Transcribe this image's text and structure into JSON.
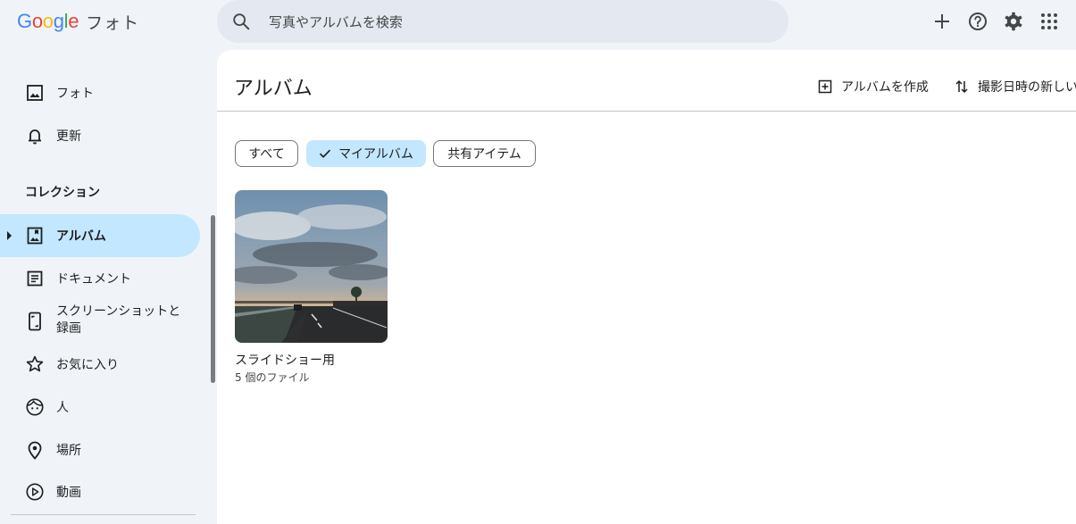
{
  "header": {
    "logo_text": "Google",
    "app_name": "フォト",
    "search_placeholder": "写真やアルバムを検索",
    "buttons": [
      {
        "name": "add",
        "icon": "plus-icon"
      },
      {
        "name": "help",
        "icon": "help-icon"
      },
      {
        "name": "settings",
        "icon": "gear-icon"
      },
      {
        "name": "apps",
        "icon": "apps-grid-icon"
      }
    ]
  },
  "sidebar": {
    "items": [
      {
        "label": "フォト",
        "icon": "photo-icon"
      },
      {
        "label": "更新",
        "icon": "bell-icon"
      }
    ],
    "collection_heading": "コレクション",
    "collection_items": [
      {
        "label": "アルバム",
        "icon": "album-icon",
        "active": true
      },
      {
        "label": "ドキュメント",
        "icon": "document-icon"
      },
      {
        "label": "スクリーンショットと",
        "label2": "録画",
        "icon": "phone-screenshot-icon"
      },
      {
        "label": "お気に入り",
        "icon": "star-icon"
      },
      {
        "label": "人",
        "icon": "face-icon"
      },
      {
        "label": "場所",
        "icon": "location-pin-icon"
      },
      {
        "label": "動画",
        "icon": "play-circle-icon"
      }
    ]
  },
  "main": {
    "title": "アルバム",
    "actions": {
      "create_album": "アルバムを作成",
      "sort": "撮影日時の新しい"
    },
    "filters": [
      {
        "label": "すべて",
        "selected": false
      },
      {
        "label": "マイアルバム",
        "selected": true
      },
      {
        "label": "共有アイテム",
        "selected": false
      }
    ],
    "albums": [
      {
        "title": "スライドショー用",
        "count": "5 個のファイル"
      }
    ]
  },
  "colors": {
    "background": "#f0f4f9",
    "active": "#c2e7ff",
    "search": "#e4e9f1",
    "text": "#1f1f1f"
  }
}
